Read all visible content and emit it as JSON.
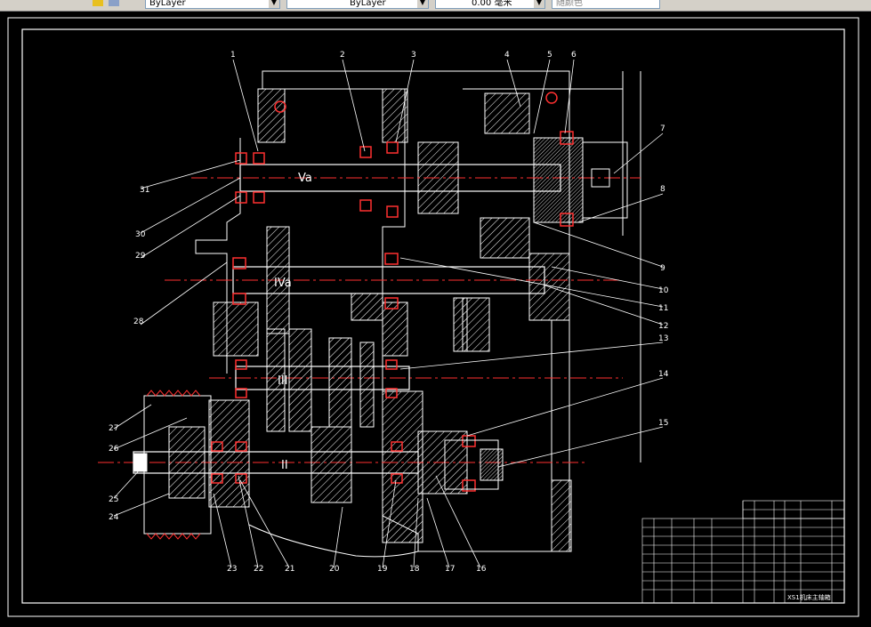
{
  "toolbar": {
    "layer_combo": "ByLayer",
    "linetype_combo": "ByLayer",
    "lineweight_combo": "0.00 毫米",
    "color_combo": "随颜色"
  },
  "drawing": {
    "shaft_labels": [
      "Va",
      "IVa",
      "III",
      "II"
    ],
    "callouts": [
      "1",
      "2",
      "3",
      "4",
      "5",
      "6",
      "7",
      "8",
      "9",
      "10",
      "11",
      "12",
      "13",
      "14",
      "15",
      "16",
      "17",
      "18",
      "19",
      "20",
      "21",
      "22",
      "23",
      "24",
      "25",
      "26",
      "27",
      "28",
      "29",
      "30",
      "31"
    ],
    "title_block_name": "XS1机床主轴箱"
  },
  "colors": {
    "background": "#000000",
    "frame": "#ffffff",
    "part_red": "#ff3030",
    "centerline": "#ff3030",
    "text": "#ffffff"
  }
}
